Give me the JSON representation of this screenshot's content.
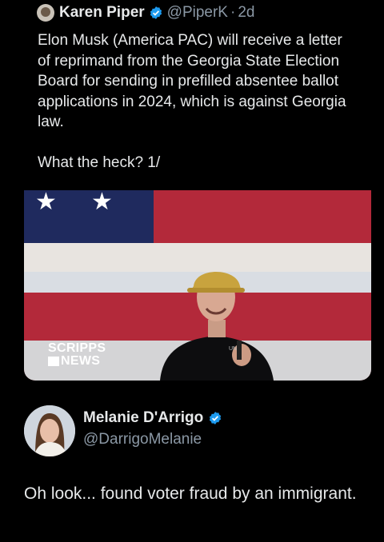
{
  "quoted_tweet": {
    "author_name": "Karen Piper",
    "handle": "@PiperK",
    "separator": "·",
    "time": "2d",
    "verified": true,
    "paragraph1": "Elon Musk (America PAC) will receive a letter of reprimand from the Georgia State Election Board for sending in prefilled absentee ballot applications in 2024, which is against Georgia law.",
    "paragraph2": "What the heck? 1/",
    "image_logo_line1": "SCRIPPS",
    "image_logo_line2": "NEWS"
  },
  "reply": {
    "author_name": "Melanie D'Arrigo",
    "handle": "@DarrigoMelanie",
    "verified": true,
    "text": "Oh look... found voter fraud by an immigrant."
  },
  "colors": {
    "background": "#000000",
    "text": "#e7e9ea",
    "secondary_text": "#8b98a5",
    "verified_badge": "#1d9bf0",
    "flag_red": "#b3293a",
    "flag_blue": "#1f2a5e"
  },
  "icons": {
    "verified": "verified-badge-icon"
  }
}
